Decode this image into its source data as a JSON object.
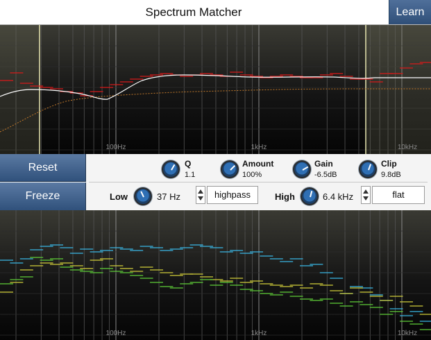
{
  "title": "Spectrum Matcher",
  "learn_label": "Learn",
  "reset_label": "Reset",
  "freeze_label": "Freeze",
  "freq_labels": [
    "100Hz",
    "1kHz",
    "10kHz"
  ],
  "knobs": {
    "q": {
      "label": "Q",
      "value": "1.1"
    },
    "amount": {
      "label": "Amount",
      "value": "100%"
    },
    "gain": {
      "label": "Gain",
      "value": "-6.5dB"
    },
    "clip": {
      "label": "Clip",
      "value": "9.8dB"
    }
  },
  "low": {
    "label": "Low",
    "value": "37 Hz",
    "filter": "highpass"
  },
  "high": {
    "label": "High",
    "value": "6.4 kHz",
    "filter": "flat"
  },
  "colors": {
    "accent": "#355985",
    "curve": "#ffffff",
    "target_bars": "#d81a1a",
    "source_curve": "#c47a2a",
    "markers": "#e8e6b0",
    "bars_cyan": "#3ab8e6",
    "bars_yellow": "#d2cf3a",
    "bars_green": "#5fd038"
  }
}
